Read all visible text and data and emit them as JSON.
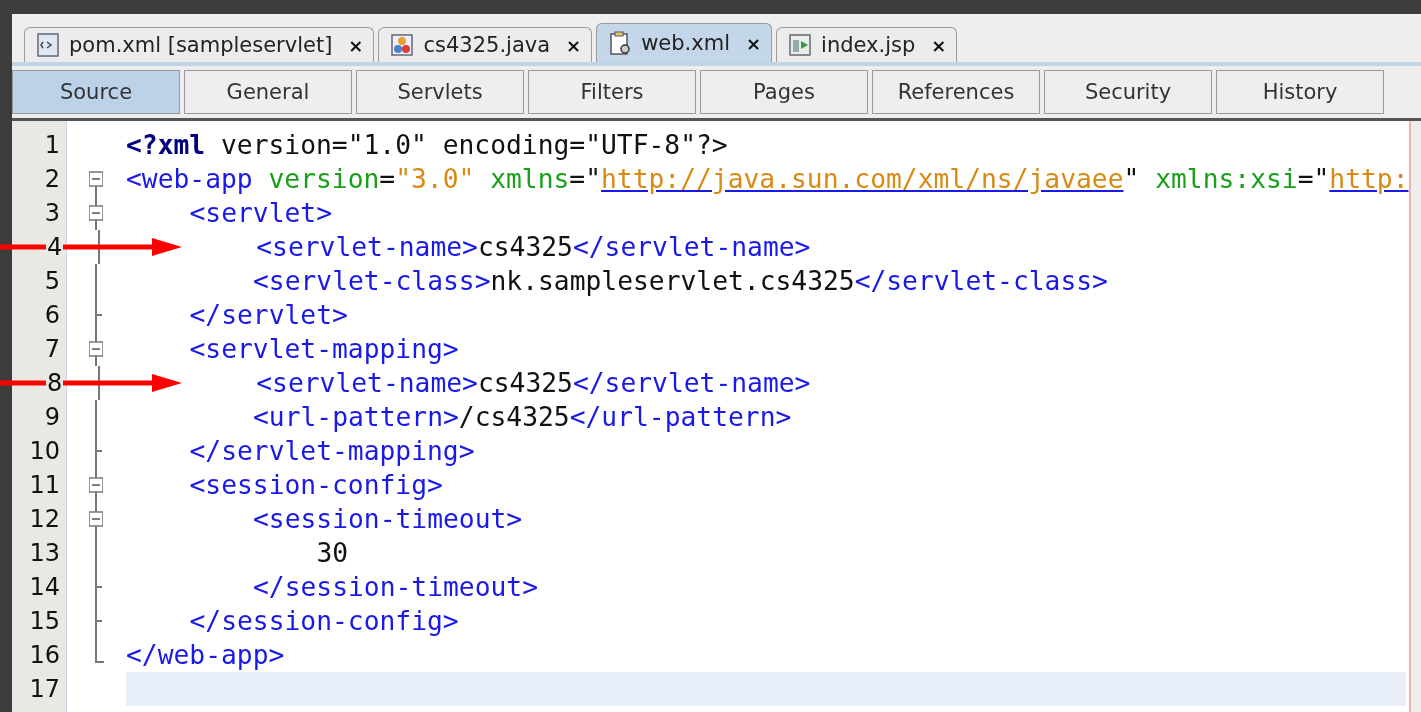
{
  "file_tabs": [
    {
      "label": "pom.xml [sampleservlet]",
      "kind": "xml",
      "selected": false,
      "close": "×"
    },
    {
      "label": "cs4325.java",
      "kind": "java",
      "selected": false,
      "close": "×"
    },
    {
      "label": "web.xml",
      "kind": "config",
      "selected": true,
      "close": "×"
    },
    {
      "label": "index.jsp",
      "kind": "jsp",
      "selected": false,
      "close": "×"
    }
  ],
  "view_tabs": [
    {
      "label": "Source",
      "selected": true
    },
    {
      "label": "General",
      "selected": false
    },
    {
      "label": "Servlets",
      "selected": false
    },
    {
      "label": "Filters",
      "selected": false
    },
    {
      "label": "Pages",
      "selected": false
    },
    {
      "label": "References",
      "selected": false
    },
    {
      "label": "Security",
      "selected": false
    },
    {
      "label": "History",
      "selected": false
    }
  ],
  "editor": {
    "lines": [
      {
        "number": "1",
        "tokens": [
          {
            "kind": "pi",
            "text": "<?xml"
          },
          {
            "kind": "text",
            "text": " version=\"1.0\" encoding=\"UTF-8\"?>"
          }
        ]
      },
      {
        "number": "2",
        "tokens": [
          {
            "kind": "tag",
            "text": "<web-app"
          },
          {
            "kind": "attr",
            "text": " version"
          },
          {
            "kind": "text",
            "text": "="
          },
          {
            "kind": "value",
            "text": "\"3.0\""
          },
          {
            "kind": "attr",
            "text": " xmlns"
          },
          {
            "kind": "text",
            "text": "=\""
          },
          {
            "kind": "link",
            "text": "http://java.sun.com/xml/ns/javaee"
          },
          {
            "kind": "text",
            "text": "\""
          },
          {
            "kind": "attr",
            "text": " xmlns:xsi"
          },
          {
            "kind": "text",
            "text": "=\""
          },
          {
            "kind": "link",
            "text": "http:"
          }
        ],
        "children": [
          {
            "number": "3",
            "tokens": [
              {
                "kind": "tag",
                "text": "<servlet>"
              }
            ],
            "children": [
              {
                "number": "4",
                "arrow": true,
                "tokens": [
                  {
                    "kind": "tag",
                    "text": "<servlet-name>"
                  },
                  {
                    "kind": "text",
                    "text": "cs4325"
                  },
                  {
                    "kind": "tag",
                    "text": "</servlet-name>"
                  }
                ]
              },
              {
                "number": "5",
                "tokens": [
                  {
                    "kind": "tag",
                    "text": "<servlet-class>"
                  },
                  {
                    "kind": "text",
                    "text": "nk.sampleservlet.cs4325"
                  },
                  {
                    "kind": "tag",
                    "text": "</servlet-class>"
                  }
                ]
              }
            ],
            "close": {
              "number": "6",
              "tokens": [
                {
                  "kind": "tag",
                  "text": "</servlet>"
                }
              ]
            }
          },
          {
            "number": "7",
            "tokens": [
              {
                "kind": "tag",
                "text": "<servlet-mapping>"
              }
            ],
            "children": [
              {
                "number": "8",
                "arrow": true,
                "tokens": [
                  {
                    "kind": "tag",
                    "text": "<servlet-name>"
                  },
                  {
                    "kind": "text",
                    "text": "cs4325"
                  },
                  {
                    "kind": "tag",
                    "text": "</servlet-name>"
                  }
                ]
              },
              {
                "number": "9",
                "tokens": [
                  {
                    "kind": "tag",
                    "text": "<url-pattern>"
                  },
                  {
                    "kind": "text",
                    "text": "/cs4325"
                  },
                  {
                    "kind": "tag",
                    "text": "</url-pattern>"
                  }
                ]
              }
            ],
            "close": {
              "number": "10",
              "tokens": [
                {
                  "kind": "tag",
                  "text": "</servlet-mapping>"
                }
              ]
            }
          },
          {
            "number": "11",
            "tokens": [
              {
                "kind": "tag",
                "text": "<session-config>"
              }
            ],
            "children": [
              {
                "number": "12",
                "tokens": [
                  {
                    "kind": "tag",
                    "text": "<session-timeout>"
                  }
                ],
                "children": [
                  {
                    "number": "13",
                    "tokens": [
                      {
                        "kind": "text",
                        "text": "30"
                      }
                    ]
                  }
                ],
                "close": {
                  "number": "14",
                  "tokens": [
                    {
                      "kind": "tag",
                      "text": "</session-timeout>"
                    }
                  ]
                }
              }
            ],
            "close": {
              "number": "15",
              "tokens": [
                {
                  "kind": "tag",
                  "text": "</session-config>"
                }
              ]
            }
          }
        ],
        "close": {
          "number": "16",
          "tokens": [
            {
              "kind": "tag",
              "text": "</web-app>"
            }
          ]
        }
      },
      {
        "number": "17",
        "current": true
      }
    ]
  }
}
